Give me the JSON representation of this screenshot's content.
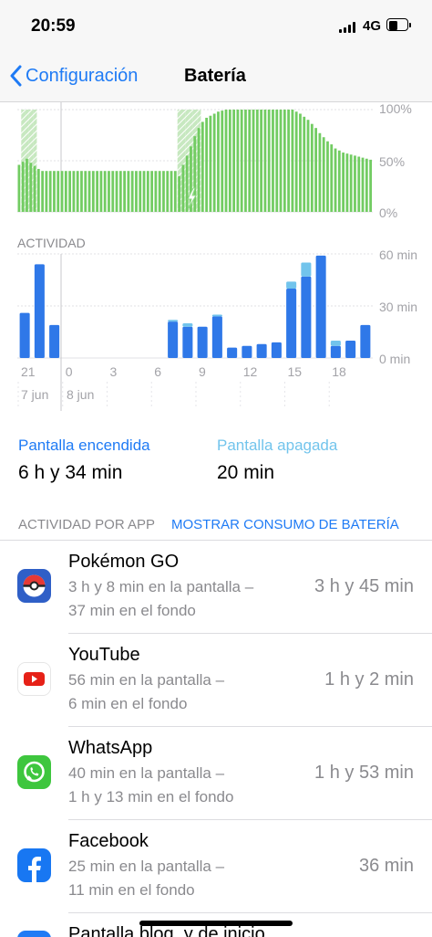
{
  "status_bar": {
    "time": "20:59",
    "network": "4G"
  },
  "nav": {
    "back_label": "Configuración",
    "title": "Batería"
  },
  "battery_chart": {
    "y_ticks": [
      "100%",
      "50%",
      "0%"
    ]
  },
  "activity": {
    "section_label": "ACTIVIDAD",
    "y_ticks": [
      "60 min",
      "30 min",
      "0 min"
    ],
    "x_ticks": [
      "21",
      "0",
      "3",
      "6",
      "9",
      "12",
      "15",
      "18"
    ],
    "date_labels": [
      "7 jun",
      "8 jun"
    ]
  },
  "summary": {
    "screen_on_label": "Pantalla encendida",
    "screen_on_value": "6 h y 34 min",
    "screen_off_label": "Pantalla apagada",
    "screen_off_value": "20 min"
  },
  "app_activity": {
    "header": "ACTIVIDAD POR APP",
    "show_usage_link": "MOSTRAR CONSUMO DE BATERÍA",
    "apps": [
      {
        "name": "Pokémon GO",
        "detail_line1": "3 h y 8 min en la pantalla –",
        "detail_line2": "37 min en el fondo",
        "time": "3 h y 45 min",
        "icon": "pokemon-go-icon"
      },
      {
        "name": "YouTube",
        "detail_line1": "56 min en la pantalla –",
        "detail_line2": "6 min en el fondo",
        "time": "1 h y 2 min",
        "icon": "youtube-icon"
      },
      {
        "name": "WhatsApp",
        "detail_line1": "40 min en la pantalla –",
        "detail_line2": "1 h y 13 min en el fondo",
        "time": "1 h y 53 min",
        "icon": "whatsapp-icon"
      },
      {
        "name": "Facebook",
        "detail_line1": "25 min en la pantalla –",
        "detail_line2": "11 min en el fondo",
        "time": "36 min",
        "icon": "facebook-icon"
      },
      {
        "name": "Pantalla bloq. y de inicio",
        "icon": "home-lock-screen-icon"
      }
    ]
  },
  "chart_data": [
    {
      "type": "area",
      "title": "",
      "ylabel": "",
      "ylim": [
        0,
        100
      ],
      "grid": true,
      "charging_periods": [
        [
          1,
          4
        ],
        [
          41,
          46
        ]
      ],
      "values": [
        46,
        49,
        52,
        48,
        45,
        42,
        40,
        40,
        40,
        40,
        40,
        40,
        40,
        40,
        40,
        40,
        40,
        40,
        40,
        40,
        40,
        40,
        40,
        40,
        40,
        40,
        40,
        40,
        40,
        40,
        40,
        40,
        40,
        40,
        40,
        40,
        40,
        40,
        40,
        40,
        40,
        35,
        46,
        55,
        64,
        74,
        82,
        88,
        92,
        94,
        96,
        98,
        99,
        100,
        100,
        100,
        100,
        100,
        100,
        100,
        100,
        100,
        100,
        100,
        100,
        100,
        100,
        100,
        100,
        100,
        100,
        98,
        96,
        93,
        90,
        86,
        82,
        77,
        73,
        69,
        66,
        62,
        60,
        58,
        57,
        56,
        55,
        54,
        53,
        52,
        51
      ]
    },
    {
      "type": "bar",
      "title": "",
      "xlabel": "",
      "ylabel": "",
      "ylim": [
        0,
        60
      ],
      "x": [
        21,
        22,
        23,
        0,
        1,
        2,
        3,
        4,
        5,
        6,
        7,
        8,
        9,
        10,
        11,
        12,
        13,
        14,
        15,
        16,
        17,
        18,
        19,
        20
      ],
      "series": [
        {
          "values": [
            26,
            54,
            19,
            0,
            0,
            0,
            0,
            0,
            0,
            0,
            21,
            18,
            18,
            24,
            6,
            7,
            8,
            9,
            40,
            47,
            59,
            7,
            10,
            19
          ]
        },
        {
          "values": [
            0,
            0,
            0,
            0,
            0,
            0,
            0,
            0,
            0,
            0,
            1,
            2,
            0,
            1,
            0,
            0,
            0,
            0,
            4,
            8,
            0,
            3,
            0,
            0
          ]
        }
      ]
    }
  ]
}
